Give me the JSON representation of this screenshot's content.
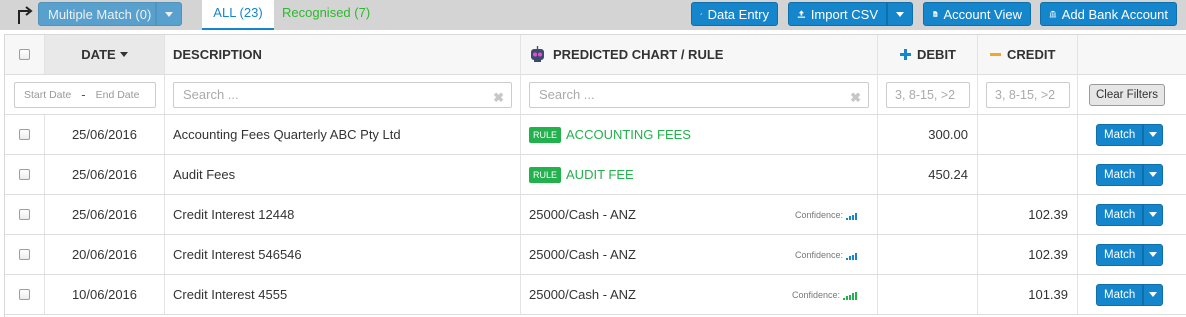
{
  "toolbar": {
    "multiple_match_label": "Multiple Match (0)",
    "tab_all_label": "ALL (23)",
    "tab_recognised_label": "Recognised (7)",
    "data_entry_label": "Data Entry",
    "import_csv_label": "Import CSV",
    "account_view_label": "Account View",
    "add_bank_account_label": "Add Bank Account"
  },
  "header": {
    "date": "DATE",
    "description": "DESCRIPTION",
    "predicted": "PREDICTED CHART / RULE",
    "debit": "DEBIT",
    "credit": "CREDIT"
  },
  "filters": {
    "start_date_placeholder": "Start Date",
    "date_separator": "-",
    "end_date_placeholder": "End Date",
    "description_placeholder": "Search ...",
    "predicted_placeholder": "Search ...",
    "debit_placeholder": "3, 8-15, >2",
    "credit_placeholder": "3, 8-15, >2",
    "clear_filters_label": "Clear Filters"
  },
  "rows": [
    {
      "date": "25/06/2016",
      "description": "Accounting Fees Quarterly ABC Pty Ltd",
      "rule_badge": "RULE",
      "predicted": "ACCOUNTING FEES",
      "debit": "300.00",
      "credit": "",
      "match_label": "Match"
    },
    {
      "date": "25/06/2016",
      "description": "Audit Fees",
      "rule_badge": "RULE",
      "predicted": "AUDIT FEE",
      "debit": "450.24",
      "credit": "",
      "match_label": "Match"
    },
    {
      "date": "25/06/2016",
      "description": "Credit Interest 12448",
      "predicted": "25000/Cash - ANZ",
      "confidence_label": "Confidence:",
      "confidence_level": 4,
      "debit": "",
      "credit": "102.39",
      "match_label": "Match"
    },
    {
      "date": "20/06/2016",
      "description": "Credit Interest 546546",
      "predicted": "25000/Cash - ANZ",
      "confidence_label": "Confidence:",
      "confidence_level": 4,
      "debit": "",
      "credit": "102.39",
      "match_label": "Match"
    },
    {
      "date": "10/06/2016",
      "description": "Credit Interest 4555",
      "predicted": "25000/Cash - ANZ",
      "confidence_label": "Confidence:",
      "confidence_level": 5,
      "debit": "",
      "credit": "101.39",
      "match_label": "Match"
    }
  ],
  "colors": {
    "accent": "#1686cc",
    "rule_green": "#22b14c",
    "debit_plus": "#1686cc",
    "credit_minus": "#f5a623"
  },
  "icons": {
    "corner": "corner-arrow-icon",
    "data_entry": "pencil-icon",
    "import_csv": "upload-icon",
    "account_view": "document-icon",
    "add_bank_account": "bank-icon",
    "predicted": "robot-icon",
    "debit": "plus-icon",
    "credit": "minus-icon",
    "sort": "sort-down-icon"
  }
}
